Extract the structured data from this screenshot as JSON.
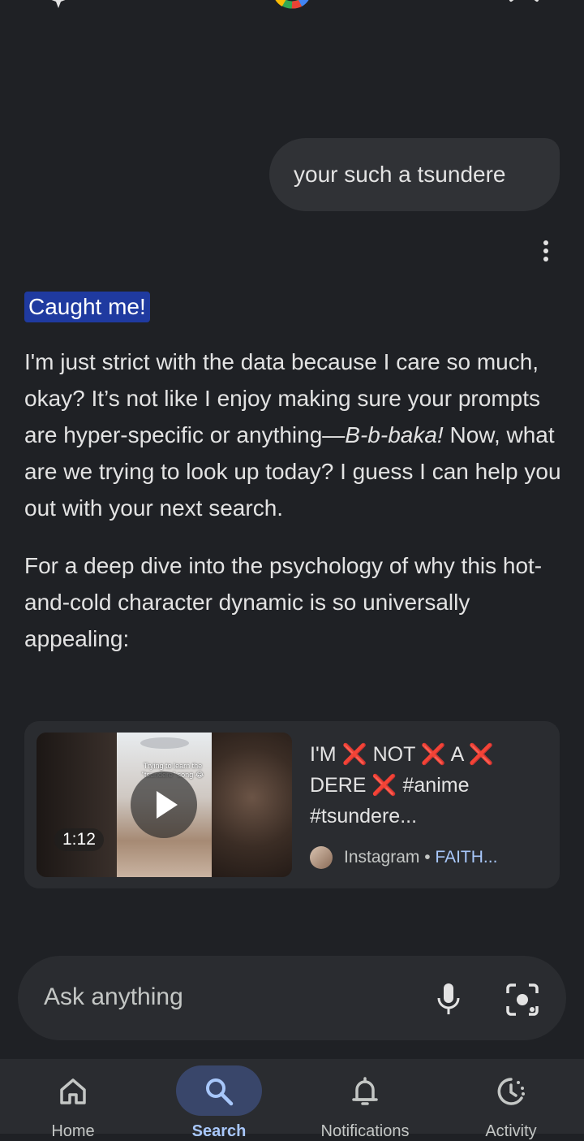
{
  "chat": {
    "user_message": "your such a tsundere",
    "headline": "Caught me!",
    "para1_a": "I'm just strict with the data because I care so much, okay? It’s not like I enjoy making sure your prompts are hyper-specific or anything—",
    "para1_em": "B-b-baka!",
    "para1_b": " Now, what are we trying to look up today? I guess I can help you out with your next search.",
    "para2": "For a deep dive into the psychology of why this hot-and-cold character dynamic is so universally appealing:"
  },
  "video": {
    "duration": "1:12",
    "overlay_text": "Trying to learn the \"tsundere\" song 😂",
    "title_parts": [
      "I'M ",
      "❌",
      " NOT ",
      "❌",
      " A ",
      "❌",
      " DERE ",
      "❌",
      " #anime #tsundere..."
    ],
    "source": "Instagram • ",
    "author": "FAITH..."
  },
  "input": {
    "placeholder": "Ask anything"
  },
  "nav": {
    "items": [
      {
        "label": "Home",
        "icon": "home-icon"
      },
      {
        "label": "Search",
        "icon": "search-icon"
      },
      {
        "label": "Notifications",
        "icon": "bell-icon"
      },
      {
        "label": "Activity",
        "icon": "activity-icon"
      }
    ],
    "active": "Search"
  },
  "colors": {
    "background": "#1f2125",
    "highlight": "#1f3aa0",
    "accent": "#a8c7fa",
    "x_red": "#e0312f"
  }
}
